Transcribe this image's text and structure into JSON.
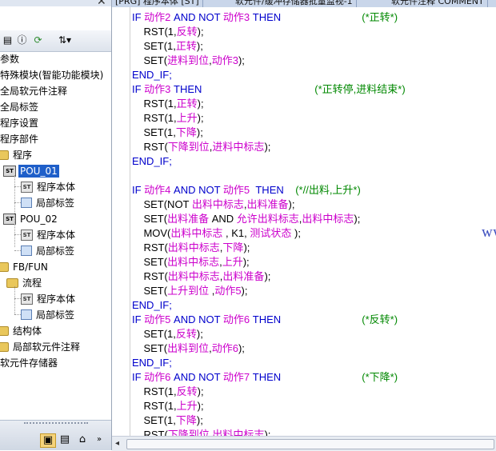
{
  "tabs": [
    "[PRG] 程序本体 [ST]",
    "软元件/缓冲存储器批量监视-1",
    "软元件注释 COMMENT"
  ],
  "nav": {
    "items": [
      {
        "label": "参数",
        "selected": false
      },
      {
        "label": "特殊模块(智能功能模块)",
        "selected": false
      },
      {
        "label": "全局软元件注释",
        "selected": false
      },
      {
        "label": "全局标签",
        "selected": false
      },
      {
        "label": "程序设置",
        "selected": false
      },
      {
        "label": "程序部件",
        "selected": false
      },
      {
        "label": "程序",
        "selected": false
      },
      {
        "label": "POU_01",
        "selected": true
      },
      {
        "label": "程序本体",
        "selected": false
      },
      {
        "label": "局部标签",
        "selected": false
      },
      {
        "label": "POU_02",
        "selected": false
      },
      {
        "label": "程序本体",
        "selected": false
      },
      {
        "label": "局部标签",
        "selected": false
      },
      {
        "label": "FB/FUN",
        "selected": false
      },
      {
        "label": "流程",
        "selected": false
      },
      {
        "label": "程序本体",
        "selected": false
      },
      {
        "label": "局部标签",
        "selected": false
      },
      {
        "label": "结构体",
        "selected": false
      },
      {
        "label": "局部软元件注释",
        "selected": false
      },
      {
        "label": "软元件存储器",
        "selected": false
      }
    ]
  },
  "code": [
    [
      {
        "t": "IF ",
        "c": "kw"
      },
      {
        "t": "动作2",
        "c": "vr"
      },
      {
        "t": " AND NOT ",
        "c": "kw"
      },
      {
        "t": "动作3",
        "c": "vr"
      },
      {
        "t": " THEN",
        "c": "kw"
      },
      {
        "t": "                            (*正转*)",
        "c": "cm"
      }
    ],
    [
      {
        "t": "    RST(1,",
        "c": "pl"
      },
      {
        "t": "反转",
        "c": "vr"
      },
      {
        "t": ");",
        "c": "pl"
      }
    ],
    [
      {
        "t": "    SET(1,",
        "c": "pl"
      },
      {
        "t": "正转",
        "c": "vr"
      },
      {
        "t": ");",
        "c": "pl"
      }
    ],
    [
      {
        "t": "    SET(",
        "c": "pl"
      },
      {
        "t": "进料到位",
        "c": "vr"
      },
      {
        "t": ",",
        "c": "pl"
      },
      {
        "t": "动作3",
        "c": "vr"
      },
      {
        "t": ");",
        "c": "pl"
      }
    ],
    [
      {
        "t": "END_IF;",
        "c": "kw"
      }
    ],
    [
      {
        "t": "IF ",
        "c": "kw"
      },
      {
        "t": "动作3",
        "c": "vr"
      },
      {
        "t": " THEN",
        "c": "kw"
      },
      {
        "t": "                                       (*正转停,进料结束*)",
        "c": "cm"
      }
    ],
    [
      {
        "t": "    RST(1,",
        "c": "pl"
      },
      {
        "t": "正转",
        "c": "vr"
      },
      {
        "t": ");",
        "c": "pl"
      }
    ],
    [
      {
        "t": "    RST(1,",
        "c": "pl"
      },
      {
        "t": "上升",
        "c": "vr"
      },
      {
        "t": ");",
        "c": "pl"
      }
    ],
    [
      {
        "t": "    SET(1,",
        "c": "pl"
      },
      {
        "t": "下降",
        "c": "vr"
      },
      {
        "t": ");",
        "c": "pl"
      }
    ],
    [
      {
        "t": "    RST(",
        "c": "pl"
      },
      {
        "t": "下降到位",
        "c": "vr"
      },
      {
        "t": ",",
        "c": "pl"
      },
      {
        "t": "进料中标志",
        "c": "vr"
      },
      {
        "t": ");",
        "c": "pl"
      }
    ],
    [
      {
        "t": "END_IF;",
        "c": "kw"
      }
    ],
    [],
    [
      {
        "t": "IF ",
        "c": "kw"
      },
      {
        "t": "动作4",
        "c": "vr"
      },
      {
        "t": " AND NOT ",
        "c": "kw"
      },
      {
        "t": "动作5",
        "c": "vr"
      },
      {
        "t": "  THEN",
        "c": "kw"
      },
      {
        "t": "    (*//出料,上升*)",
        "c": "cm"
      }
    ],
    [
      {
        "t": "    SET(NOT ",
        "c": "pl"
      },
      {
        "t": "出料中标志",
        "c": "vr"
      },
      {
        "t": ",",
        "c": "pl"
      },
      {
        "t": "出料准备",
        "c": "vr"
      },
      {
        "t": ");",
        "c": "pl"
      }
    ],
    [
      {
        "t": "    SET(",
        "c": "pl"
      },
      {
        "t": "出料准备",
        "c": "vr"
      },
      {
        "t": " AND ",
        "c": "pl"
      },
      {
        "t": "允许出料标志",
        "c": "vr"
      },
      {
        "t": ",",
        "c": "pl"
      },
      {
        "t": "出料中标志",
        "c": "vr"
      },
      {
        "t": ");",
        "c": "pl"
      }
    ],
    [
      {
        "t": "    MOV(",
        "c": "pl"
      },
      {
        "t": "出料中标志",
        "c": "vr"
      },
      {
        "t": " , K1, ",
        "c": "pl"
      },
      {
        "t": "测试状态",
        "c": "vr"
      },
      {
        "t": " );",
        "c": "pl"
      }
    ],
    [
      {
        "t": "    RST(",
        "c": "pl"
      },
      {
        "t": "出料中标志",
        "c": "vr"
      },
      {
        "t": ",",
        "c": "pl"
      },
      {
        "t": "下降",
        "c": "vr"
      },
      {
        "t": ");",
        "c": "pl"
      }
    ],
    [
      {
        "t": "    SET(",
        "c": "pl"
      },
      {
        "t": "出料中标志",
        "c": "vr"
      },
      {
        "t": ",",
        "c": "pl"
      },
      {
        "t": "上升",
        "c": "vr"
      },
      {
        "t": ");",
        "c": "pl"
      }
    ],
    [
      {
        "t": "    RST(",
        "c": "pl"
      },
      {
        "t": "出料中标志",
        "c": "vr"
      },
      {
        "t": ",",
        "c": "pl"
      },
      {
        "t": "出料准备",
        "c": "vr"
      },
      {
        "t": ");",
        "c": "pl"
      }
    ],
    [
      {
        "t": "    SET(",
        "c": "pl"
      },
      {
        "t": "上升到位",
        "c": "vr"
      },
      {
        "t": " ,",
        "c": "pl"
      },
      {
        "t": "动作5",
        "c": "vr"
      },
      {
        "t": ");",
        "c": "pl"
      }
    ],
    [
      {
        "t": "END_IF;",
        "c": "kw"
      }
    ],
    [
      {
        "t": "IF ",
        "c": "kw"
      },
      {
        "t": "动作5",
        "c": "vr"
      },
      {
        "t": " AND NOT ",
        "c": "kw"
      },
      {
        "t": "动作6",
        "c": "vr"
      },
      {
        "t": " THEN",
        "c": "kw"
      },
      {
        "t": "                            (*反转*)",
        "c": "cm"
      }
    ],
    [
      {
        "t": "    SET(1,",
        "c": "pl"
      },
      {
        "t": "反转",
        "c": "vr"
      },
      {
        "t": ");",
        "c": "pl"
      }
    ],
    [
      {
        "t": "    SET(",
        "c": "pl"
      },
      {
        "t": "出料到位",
        "c": "vr"
      },
      {
        "t": ",",
        "c": "pl"
      },
      {
        "t": "动作6",
        "c": "vr"
      },
      {
        "t": ");",
        "c": "pl"
      }
    ],
    [
      {
        "t": "END_IF;",
        "c": "kw"
      }
    ],
    [
      {
        "t": "IF ",
        "c": "kw"
      },
      {
        "t": "动作6",
        "c": "vr"
      },
      {
        "t": " AND NOT ",
        "c": "kw"
      },
      {
        "t": "动作7",
        "c": "vr"
      },
      {
        "t": " THEN",
        "c": "kw"
      },
      {
        "t": "                            (*下降*)",
        "c": "cm"
      }
    ],
    [
      {
        "t": "    RST(1,",
        "c": "pl"
      },
      {
        "t": "反转",
        "c": "vr"
      },
      {
        "t": ");",
        "c": "pl"
      }
    ],
    [
      {
        "t": "    RST(1,",
        "c": "pl"
      },
      {
        "t": "上升",
        "c": "vr"
      },
      {
        "t": ");",
        "c": "pl"
      }
    ],
    [
      {
        "t": "    SET(1,",
        "c": "pl"
      },
      {
        "t": "下降",
        "c": "vr"
      },
      {
        "t": ");",
        "c": "pl"
      }
    ],
    [
      {
        "t": "    RST(",
        "c": "pl"
      },
      {
        "t": "下降到位",
        "c": "vr"
      },
      {
        "t": ",",
        "c": "pl"
      },
      {
        "t": "出料中标志",
        "c": "vr"
      },
      {
        "t": ");",
        "c": "pl"
      }
    ]
  ],
  "watermark": "www.eleok.com",
  "colors": {
    "keyword": "#0000cc",
    "variable": "#cc00cc",
    "comment": "#008800",
    "selection": "#1f5fc9"
  },
  "icons": {
    "nav_close": "✕",
    "toolbar": [
      "tree-view-icon",
      "properties-icon",
      "refresh-icon",
      "sort-icon"
    ],
    "bottom": [
      "project-view-icon",
      "user-library-icon",
      "connection-icon",
      "overflow-chevron-icon"
    ]
  }
}
